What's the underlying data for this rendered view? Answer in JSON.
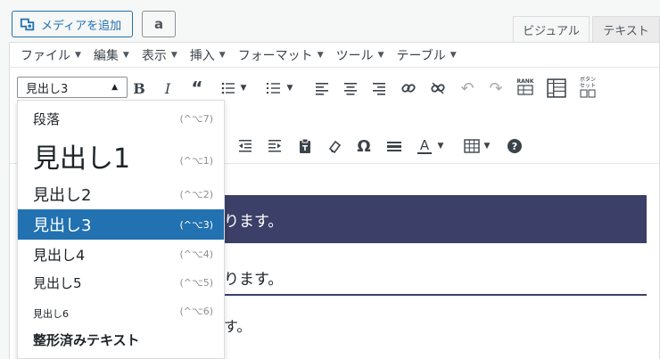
{
  "top": {
    "media_button": "メディアを追加",
    "amazon_letter": "a",
    "tab_visual": "ビジュアル",
    "tab_text": "テキスト"
  },
  "menubar": {
    "items": [
      "ファイル",
      "編集",
      "表示",
      "挿入",
      "フォーマット",
      "ツール",
      "テーブル"
    ]
  },
  "toolbar": {
    "format_value": "見出し3",
    "rank_label": "RANK",
    "button_set_label1": "ボタン",
    "button_set_label2": "セット",
    "omega": "Ω",
    "text_color_letter": "A",
    "help": "?"
  },
  "dropdown": {
    "items": [
      {
        "label": "段落",
        "shortcut": "(^⌥7)"
      },
      {
        "label": "見出し1",
        "shortcut": "(^⌥1)"
      },
      {
        "label": "見出し2",
        "shortcut": "(^⌥2)"
      },
      {
        "label": "見出し3",
        "shortcut": "(^⌥3)"
      },
      {
        "label": "見出し4",
        "shortcut": "(^⌥4)"
      },
      {
        "label": "見出し5",
        "shortcut": "(^⌥5)"
      },
      {
        "label": "見出し6",
        "shortcut": "(^⌥6)"
      },
      {
        "label": "整形済みテキスト",
        "shortcut": ""
      }
    ]
  },
  "content": {
    "h2_text": "ります。",
    "h3_text": "ります。",
    "p_text": "す。"
  },
  "colors": {
    "accent": "#2271b1",
    "heading_bar": "#3c4068"
  }
}
